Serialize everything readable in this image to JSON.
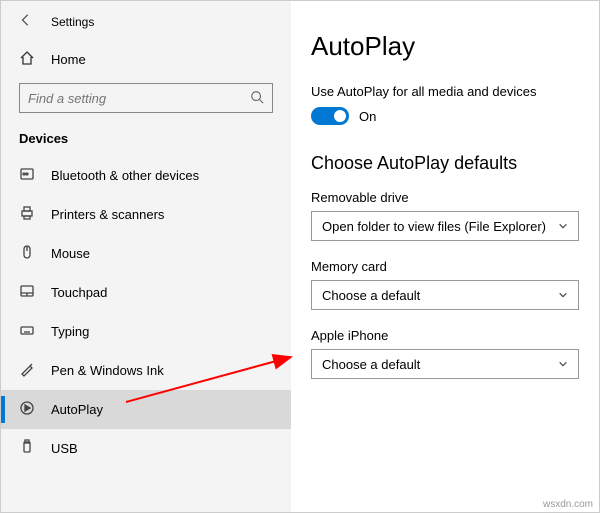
{
  "header": {
    "app_title": "Settings"
  },
  "sidebar": {
    "home_label": "Home",
    "search_placeholder": "Find a setting",
    "section_label": "Devices",
    "items": [
      {
        "label": "Bluetooth & other devices"
      },
      {
        "label": "Printers & scanners"
      },
      {
        "label": "Mouse"
      },
      {
        "label": "Touchpad"
      },
      {
        "label": "Typing"
      },
      {
        "label": "Pen & Windows Ink"
      },
      {
        "label": "AutoPlay"
      },
      {
        "label": "USB"
      }
    ]
  },
  "main": {
    "title": "AutoPlay",
    "toggle_label": "Use AutoPlay for all media and devices",
    "toggle_state": "On",
    "section_title": "Choose AutoPlay defaults",
    "dropdowns": [
      {
        "label": "Removable drive",
        "value": "Open folder to view files (File Explorer)"
      },
      {
        "label": "Memory card",
        "value": "Choose a default"
      },
      {
        "label": "Apple iPhone",
        "value": "Choose a default"
      }
    ]
  },
  "watermark": "wsxdn.com"
}
